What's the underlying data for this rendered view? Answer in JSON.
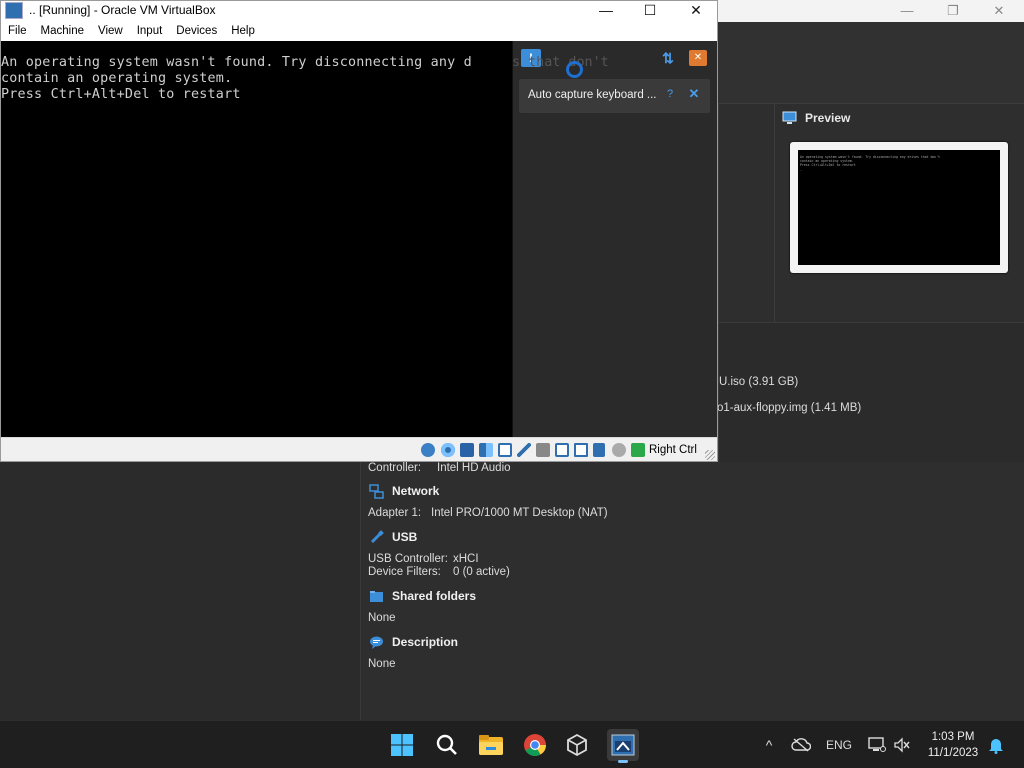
{
  "vm_window": {
    "title": ".. [Running] - Oracle VM VirtualBox",
    "controls": {
      "minimize": "—",
      "maximize": "☐",
      "close": "✕"
    },
    "menu": [
      "File",
      "Machine",
      "View",
      "Input",
      "Devices",
      "Help"
    ],
    "console_lines": [
      "An operating system wasn't found. Try disconnecting any d",
      "contain an operating system.",
      "Press Ctrl+Alt+Del to restart"
    ],
    "console_overflow": "s that don't",
    "notification": {
      "text": "Auto capture keyboard ...",
      "message_icon": "!",
      "sort_icon": "⇅",
      "clear_icon": "✕",
      "help_icon": "?",
      "close_icon": "✕"
    },
    "statusbar": {
      "host_key": "Right Ctrl",
      "icons": [
        "hard-disk-icon",
        "optical-drive-icon",
        "floppy-icon",
        "audio-icon",
        "network-icon",
        "usb-icon",
        "shared-folders-icon",
        "display-icon",
        "recording-icon",
        "cpu-icon",
        "mouse-integration-icon",
        "keyboard-icon"
      ]
    }
  },
  "manager_window": {
    "controls": {
      "minimize": "—",
      "maximize": "❐",
      "close": "✕"
    },
    "preview": {
      "title": "Preview",
      "screen_lines": [
        "An operating system wasn't found. Try disconnecting any drives that don't",
        "contain an operating system.",
        "Press Ctrl+Alt+Del to restart",
        "_"
      ]
    },
    "storage": {
      "optical": "U.iso (3.91 GB)",
      "floppy": "o1-aux-floppy.img (1.41 MB)"
    },
    "audio": {
      "controller_label": "Controller:",
      "controller_value": "Intel HD Audio"
    },
    "network": {
      "title": "Network",
      "adapter_label": "Adapter 1:",
      "adapter_value": "Intel PRO/1000 MT Desktop (NAT)"
    },
    "usb": {
      "title": "USB",
      "controller_label": "USB Controller:",
      "controller_value": "xHCI",
      "filters_label": "Device Filters:",
      "filters_value": "0 (0 active)"
    },
    "shared_folders": {
      "title": "Shared folders",
      "value": "None"
    },
    "description": {
      "title": "Description",
      "value": "None"
    }
  },
  "taskbar": {
    "apps": [
      "start",
      "search",
      "file-explorer",
      "chrome",
      "virtualbox",
      "virtualbox-vm"
    ],
    "tray": {
      "chevron": "^",
      "language": "ENG"
    },
    "time": "1:03 PM",
    "date": "11/1/2023"
  },
  "colors": {
    "accent": "#3d8ed8",
    "console_bg": "#000000",
    "console_fg": "#cfcfcf",
    "taskbar": "#1f1f1f"
  }
}
